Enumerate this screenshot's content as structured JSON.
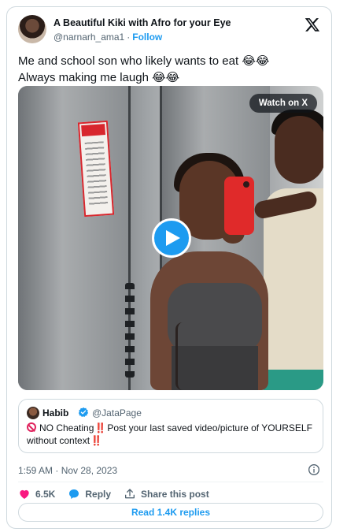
{
  "author": {
    "display_name": "A Beautiful Kiki with Afro for your Eye",
    "handle": "@narnarh_ama1",
    "separator": "·",
    "follow_label": "Follow"
  },
  "tweet": {
    "line1": "Me and school son who likely wants to eat 😂😂",
    "line2": "Always making me laugh 😂😂"
  },
  "media": {
    "watch_label": "Watch on X"
  },
  "quoted": {
    "name": "Habib",
    "handle": "@JataPage",
    "text_part1": "NO Cheating",
    "text_part2": "Post your last saved video/picture of YOURSELF",
    "text_part3": "without context",
    "bang": "‼️"
  },
  "meta": {
    "timestamp": "1:59 AM · Nov 28, 2023"
  },
  "actions": {
    "likes": "6.5K",
    "reply_label": "Reply",
    "share_label": "Share this post",
    "read_replies": "Read 1.4K replies"
  },
  "colors": {
    "accent": "#1d9bf0",
    "like": "#f91880",
    "muted": "#536471"
  }
}
